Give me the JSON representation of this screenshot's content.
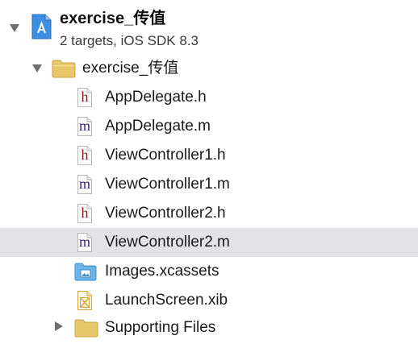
{
  "project": {
    "name": "exercise_传值",
    "subtitle": "2 targets, iOS SDK 8.3"
  },
  "group": {
    "name": "exercise_传值"
  },
  "files": [
    {
      "name": "AppDelegate.h",
      "icon": "h-file-icon",
      "letter": "h"
    },
    {
      "name": "AppDelegate.m",
      "icon": "m-file-icon",
      "letter": "m"
    },
    {
      "name": "ViewController1.h",
      "icon": "h-file-icon",
      "letter": "h"
    },
    {
      "name": "ViewController1.m",
      "icon": "m-file-icon",
      "letter": "m"
    },
    {
      "name": "ViewController2.h",
      "icon": "h-file-icon",
      "letter": "h"
    },
    {
      "name": "ViewController2.m",
      "icon": "m-file-icon",
      "letter": "m",
      "selected": true
    },
    {
      "name": "Images.xcassets",
      "icon": "asset-catalog-icon"
    },
    {
      "name": "LaunchScreen.xib",
      "icon": "xib-file-icon"
    }
  ],
  "partial_group": {
    "name": "Supporting Files"
  },
  "colors": {
    "selection": "#e3e3e7",
    "folder": "#e8c66a",
    "project_blue": "#3b8ee0",
    "h_letter": "#8b1c20",
    "m_letter": "#3c2a7a"
  }
}
